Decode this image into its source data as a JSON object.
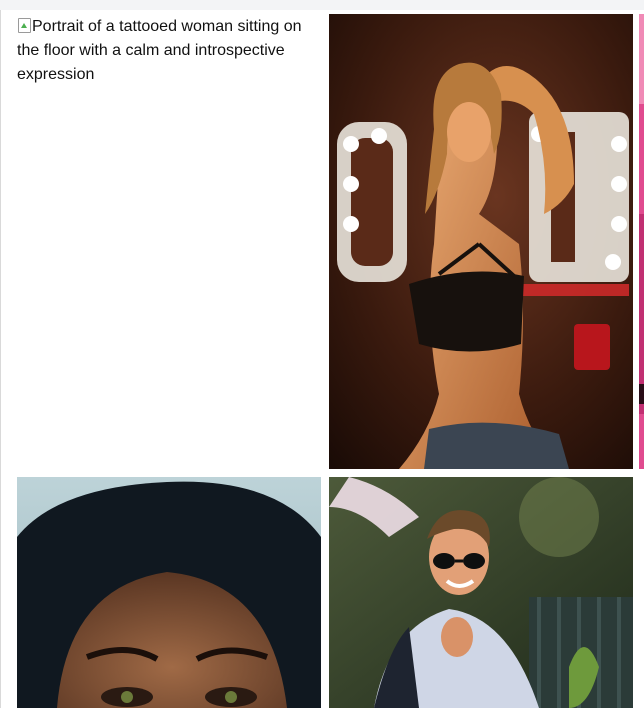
{
  "gallery": {
    "broken_image_alt": "Portrait of a tattooed woman sitting on the floor with a calm and introspective expression",
    "tiles": [
      {
        "name": "woman-pose-photo",
        "description_colors": {
          "background": "#3a1d12",
          "skin": "#d08a52",
          "top": "#1c1612",
          "sign": "#e9e4dc"
        }
      },
      {
        "name": "pink-photo-edge",
        "description_colors": {
          "background": "#e04b8f"
        }
      },
      {
        "name": "hooded-woman-photo",
        "description_colors": {
          "sky": "#b7cdd3",
          "hood": "#111820",
          "skin": "#8a5a3e"
        }
      },
      {
        "name": "smiling-man-photo",
        "description_colors": {
          "foliage": "#2f3a23",
          "shirt": "#cfd6e6"
        }
      }
    ]
  }
}
